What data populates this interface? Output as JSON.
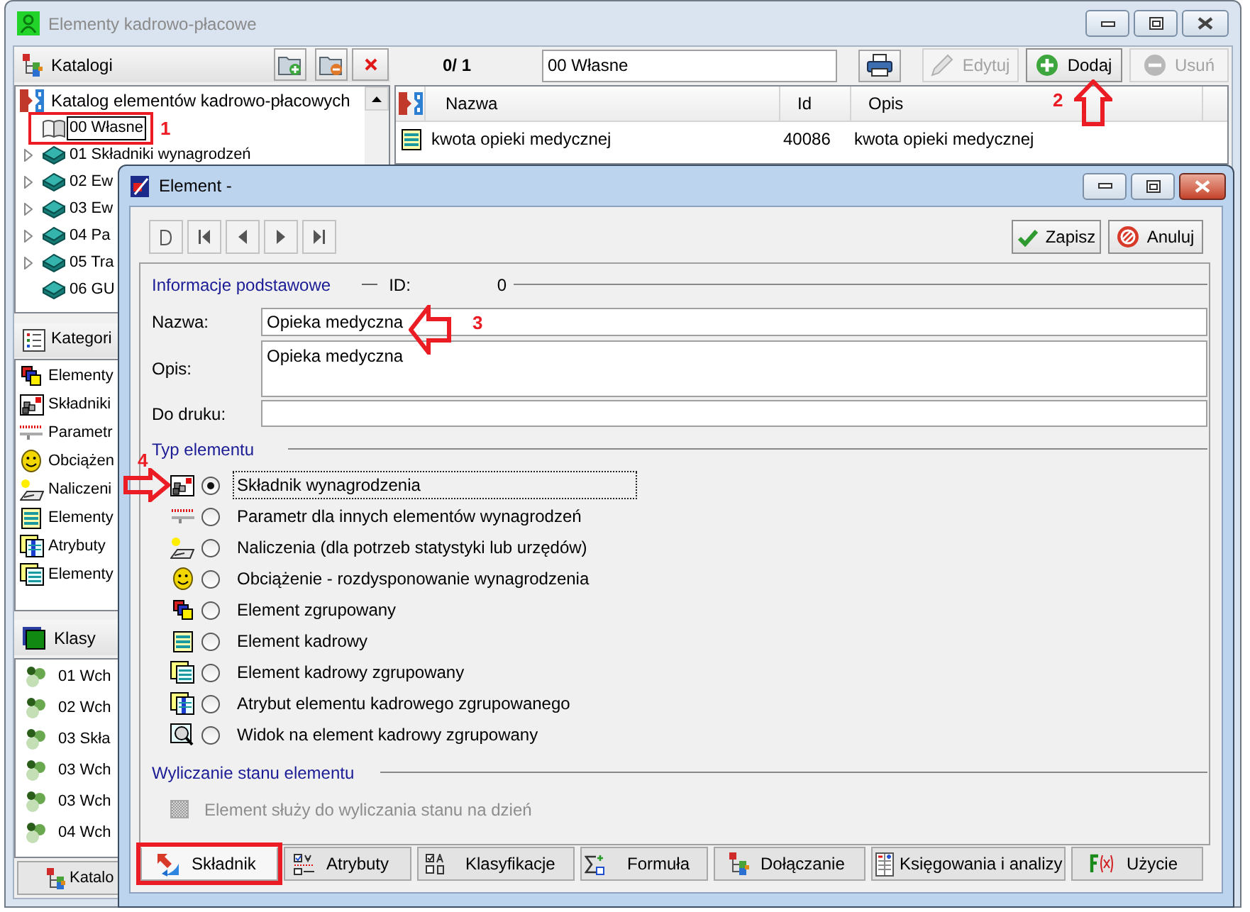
{
  "window": {
    "title": "Elementy kadrowo-płacowe",
    "active": false
  },
  "catalogs": {
    "title": "Katalogi",
    "tree": [
      {
        "label": "Katalog elementów kadrowo-płacowych",
        "children": [
          {
            "label": "00 Własne",
            "kind": "open-book",
            "selected": true,
            "expandable": false,
            "marker": "1"
          },
          {
            "label": "01 Składniki wynagrodzeń",
            "kind": "book",
            "selected": false,
            "expandable": true
          },
          {
            "label": "02 Ew",
            "kind": "book",
            "selected": false,
            "expandable": true
          },
          {
            "label": "03 Ew",
            "kind": "book",
            "selected": false,
            "expandable": true
          },
          {
            "label": "04 Pa",
            "kind": "book",
            "selected": false,
            "expandable": true
          },
          {
            "label": "05 Tra",
            "kind": "book",
            "selected": false,
            "expandable": true
          },
          {
            "label": "06 GU",
            "kind": "book",
            "selected": false,
            "expandable": false
          }
        ]
      }
    ]
  },
  "categories": {
    "title": "Kategori",
    "items": [
      {
        "label": "Elementy",
        "kind": "grouped"
      },
      {
        "label": "Składniki",
        "kind": "component"
      },
      {
        "label": "Parametr",
        "kind": "parameter"
      },
      {
        "label": "Obciążen",
        "kind": "charge"
      },
      {
        "label": "Naliczeni",
        "kind": "accrual"
      },
      {
        "label": "Elementy",
        "kind": "hr"
      },
      {
        "label": "Atrybuty",
        "kind": "hr-attribute"
      },
      {
        "label": "Elementy",
        "kind": "hr-grouped"
      }
    ]
  },
  "classes": {
    "title": "Klasy",
    "items": [
      "01 Wch",
      "02 Wch",
      "03 Skła",
      "03 Wch",
      "03 Wch",
      "04 Wch"
    ]
  },
  "bottom_tab": {
    "label": "Katalo"
  },
  "list": {
    "counter": "0/ 1",
    "filter_value": "00 Własne",
    "buttons": [
      {
        "label": "Edytuj",
        "kind": "edit",
        "disabled": true
      },
      {
        "label": "Dodaj",
        "kind": "add",
        "disabled": false,
        "marker": "2"
      },
      {
        "label": "Usuń",
        "kind": "remove",
        "disabled": true
      }
    ],
    "columns": [
      "Nazwa",
      "Id",
      "Opis"
    ],
    "rows": [
      {
        "cells": [
          "kwota opieki medycznej",
          "40086",
          "kwota opieki medycznej"
        ]
      }
    ]
  },
  "dialog": {
    "title": "Element -",
    "active": true,
    "actions": [
      {
        "label": "Zapisz",
        "kind": "save"
      },
      {
        "label": "Anuluj",
        "kind": "cancel"
      }
    ],
    "basic_info": {
      "title": "Informacje podstawowe",
      "id_label": "ID:",
      "id_value": "0",
      "fields": [
        {
          "label": "Nazwa:",
          "kind": "line",
          "value": "Opieka medyczna",
          "marker": "3"
        },
        {
          "label": "Opis:",
          "kind": "multiline",
          "value": "Opieka medyczna"
        },
        {
          "label": "Do druku:",
          "kind": "line"
        }
      ]
    },
    "element_type": {
      "title": "Typ elementu",
      "options": [
        {
          "label": "Składnik wynagrodzenia",
          "kind": "component",
          "selected": true,
          "marker": "4"
        },
        {
          "label": "Parametr dla innych elementów wynagrodzeń",
          "kind": "parameter",
          "selected": false
        },
        {
          "label": "Naliczenia (dla potrzeb statystyki lub urzędów)",
          "kind": "accrual",
          "selected": false
        },
        {
          "label": "Obciążenie - rozdysponowanie wynagrodzenia",
          "kind": "charge",
          "selected": false
        },
        {
          "label": "Element zgrupowany",
          "kind": "grouped",
          "selected": false
        },
        {
          "label": "Element kadrowy",
          "kind": "hr",
          "selected": false
        },
        {
          "label": "Element kadrowy zgrupowany",
          "kind": "hr-grouped",
          "selected": false
        },
        {
          "label": "Atrybut elementu kadrowego zgrupowanego",
          "kind": "hr-attribute",
          "selected": false
        },
        {
          "label": "Widok na element kadrowy zgrupowany",
          "kind": "hr-view",
          "selected": false
        }
      ]
    },
    "state_calculation": {
      "title": "Wyliczanie stanu elementu",
      "checkbox": {
        "label": "Element służy do wyliczania stanu na dzień",
        "checked": false,
        "disabled": true
      }
    },
    "tabs": [
      {
        "label": "Składnik",
        "kind": "component",
        "selected": true,
        "highlighted": true
      },
      {
        "label": "Atrybuty",
        "kind": "attributes",
        "selected": false,
        "highlighted": false
      },
      {
        "label": "Klasyfikacje",
        "kind": "classification",
        "selected": false,
        "highlighted": false
      },
      {
        "label": "Formuła",
        "kind": "formula",
        "selected": false,
        "highlighted": false
      },
      {
        "label": "Dołączanie",
        "kind": "joining",
        "selected": false,
        "highlighted": false
      },
      {
        "label": "Księgowania i analizy",
        "kind": "accounting",
        "selected": false,
        "highlighted": false
      },
      {
        "label": "Użycie",
        "kind": "usage",
        "selected": false,
        "highlighted": false
      }
    ]
  }
}
